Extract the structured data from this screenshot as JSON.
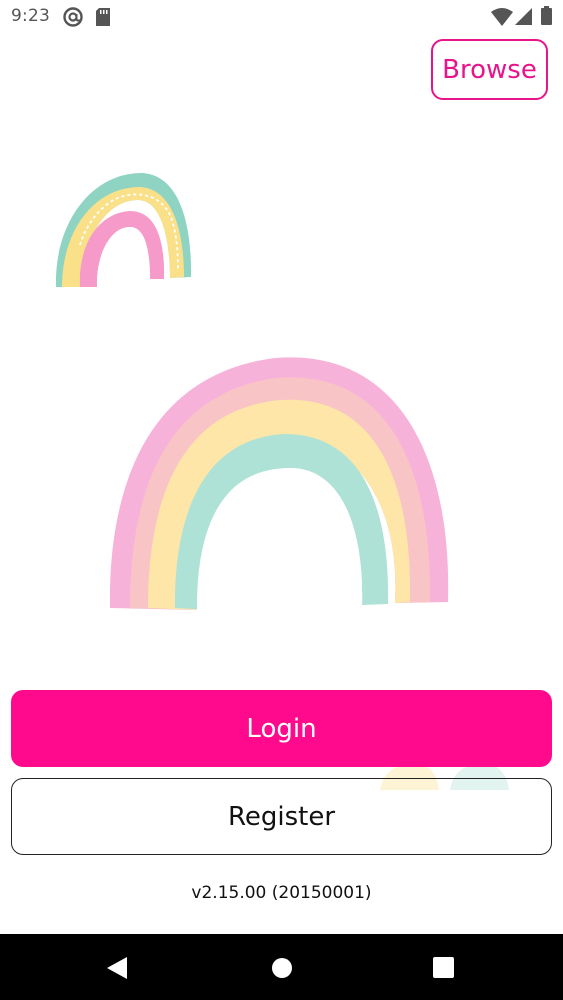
{
  "status_bar": {
    "time": "9:23",
    "icons": [
      "at-sign-icon",
      "sd-card-icon",
      "wifi-icon",
      "cell-signal-icon",
      "battery-icon"
    ]
  },
  "header": {
    "browse_label": "Browse"
  },
  "illustrations": {
    "small": "rainbow-icon",
    "large": "rainbow-icon"
  },
  "actions": {
    "login_label": "Login",
    "register_label": "Register"
  },
  "footer": {
    "version": "v2.15.00 (20150001)"
  },
  "nav_bar": {
    "icons": [
      "back-icon",
      "home-icon",
      "recents-icon"
    ]
  },
  "colors": {
    "accent": "#ff0a8d",
    "browse_border": "#e8148c"
  }
}
